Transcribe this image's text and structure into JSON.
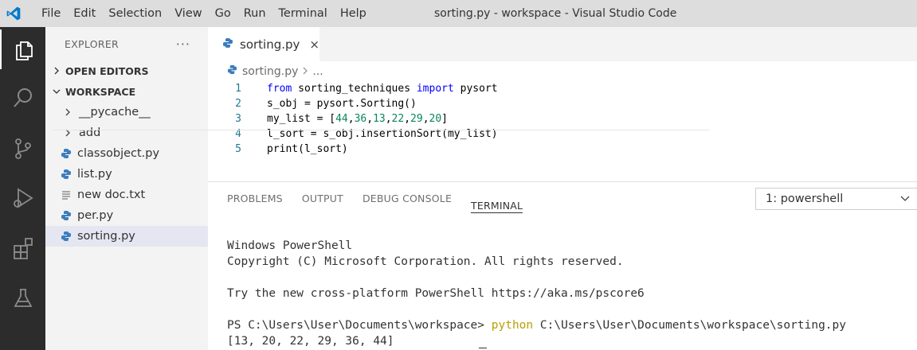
{
  "titlebar": {
    "menu": [
      "File",
      "Edit",
      "Selection",
      "View",
      "Go",
      "Run",
      "Terminal",
      "Help"
    ],
    "window_title": "sorting.py - workspace - Visual Studio Code",
    "brand_color": "#007acc"
  },
  "activity_bar": {
    "icons": [
      "explorer-icon",
      "search-icon",
      "source-control-icon",
      "run-debug-icon",
      "extensions-icon",
      "testing-icon"
    ]
  },
  "sidebar": {
    "header": "EXPLORER",
    "more": "···",
    "open_editors": "OPEN EDITORS",
    "workspace": "WORKSPACE",
    "items": [
      {
        "label": "__pycache__",
        "type": "folder"
      },
      {
        "label": "add",
        "type": "folder"
      },
      {
        "label": "classobject.py",
        "type": "python"
      },
      {
        "label": "list.py",
        "type": "python"
      },
      {
        "label": "new doc.txt",
        "type": "text"
      },
      {
        "label": "per.py",
        "type": "python"
      },
      {
        "label": "sorting.py",
        "type": "python",
        "selected": true
      }
    ]
  },
  "editor": {
    "tab": {
      "label": "sorting.py",
      "close": "×"
    },
    "breadcrumb": {
      "file": "sorting.py",
      "ellipsis": "..."
    },
    "lines": [
      {
        "n": "1",
        "text": "from sorting_techniques import pysort"
      },
      {
        "n": "2",
        "text": "s_obj = pysort.Sorting()"
      },
      {
        "n": "3",
        "text": "my_list = [44,36,13,22,29,20]"
      },
      {
        "n": "4",
        "text": "l_sort = s_obj.insertionSort(my_list)"
      },
      {
        "n": "5",
        "text": "print(l_sort)"
      }
    ]
  },
  "panel": {
    "tabs": [
      "PROBLEMS",
      "OUTPUT",
      "DEBUG CONSOLE",
      "TERMINAL"
    ],
    "active_tab": "TERMINAL",
    "terminal_select": "1: powershell",
    "terminal_lines": [
      "Windows PowerShell",
      "Copyright (C) Microsoft Corporation. All rights reserved.",
      "",
      "Try the new cross-platform PowerShell https://aka.ms/pscore6",
      "",
      "PS C:\\Users\\User\\Documents\\workspace>",
      "[13, 20, 22, 29, 36, 44]"
    ],
    "command": {
      "keyword": "python",
      "path": "C:\\Users\\User\\Documents\\workspace\\sorting.py"
    }
  }
}
